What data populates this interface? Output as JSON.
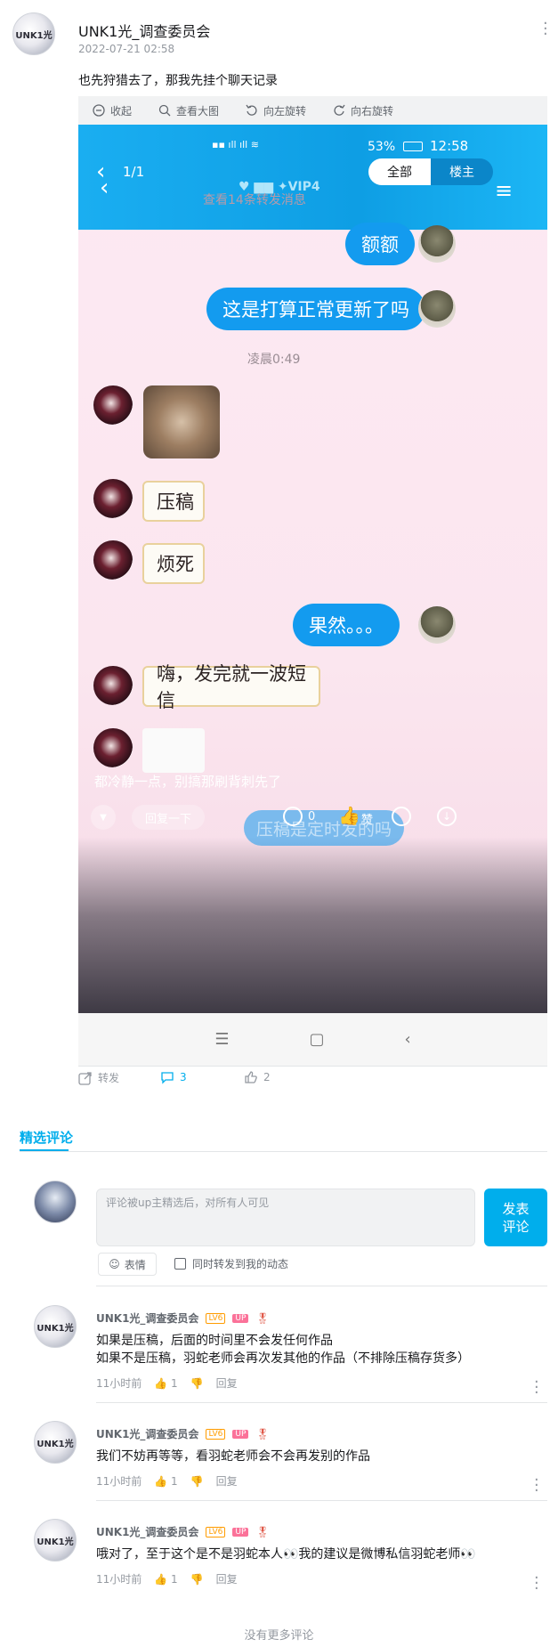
{
  "post": {
    "author": "UNK1光_调查委员会",
    "avatar_mark": "UNK1光",
    "date": "2022-07-21 02:58",
    "text": "也先狩猎去了，那我先挂个聊天记录"
  },
  "viewer": {
    "collapse": "收起",
    "view_large": "查看大图",
    "rotate_left": "向左旋转",
    "rotate_right": "向右旋转"
  },
  "chat_shot": {
    "status_time": "12:58",
    "battery": "53%",
    "counter": "1/1",
    "tab_all": "全部",
    "tab_owner": "楼主",
    "forward_hint": "查看14条转发消息",
    "time_divider": "凌晨0:49",
    "messages": [
      {
        "side": "right",
        "text": "额额"
      },
      {
        "side": "right",
        "text": "这是打算正常更新了吗"
      },
      {
        "side": "left",
        "text": "压稿"
      },
      {
        "side": "left",
        "text": "烦死"
      },
      {
        "side": "right",
        "text": "果然。。。"
      },
      {
        "side": "left",
        "text": "嗨，发完就一波短信"
      }
    ],
    "caption": "都冷静一点，别搞那刷背刺先了",
    "reply_btn": "回复一下",
    "faded_bubble": "压稿是定时发的吗",
    "comment_count": "0",
    "like_label": "赞"
  },
  "actions": {
    "forward": "转发",
    "comments": "3",
    "likes": "2"
  },
  "comments_section": {
    "tab": "精选评论",
    "placeholder": "评论被up主精选后，对所有人可见",
    "post_button": "发表评论",
    "emoji_label": "表情",
    "sync_label": "同时转发到我的动态",
    "lv_badge": "LV6",
    "up_badge": "UP",
    "no_more": "没有更多评论",
    "items": [
      {
        "name": "UNK1光_调查委员会",
        "lines": [
          "如果是压稿，后面的时间里不会发任何作品",
          "如果不是压稿，羽蛇老师会再次发其他的作品（不排除压稿存货多）"
        ],
        "time": "11小时前",
        "likes": "1",
        "reply": "回复"
      },
      {
        "name": "UNK1光_调查委员会",
        "lines": [
          "我们不妨再等等，看羽蛇老师会不会再发别的作品"
        ],
        "time": "11小时前",
        "likes": "1",
        "reply": "回复"
      },
      {
        "name": "UNK1光_调查委员会",
        "lines": [
          "哦对了，至于这个是不是羽蛇本人👀我的建议是微博私信羽蛇老师👀"
        ],
        "time": "11小时前",
        "likes": "1",
        "reply": "回复"
      }
    ]
  }
}
